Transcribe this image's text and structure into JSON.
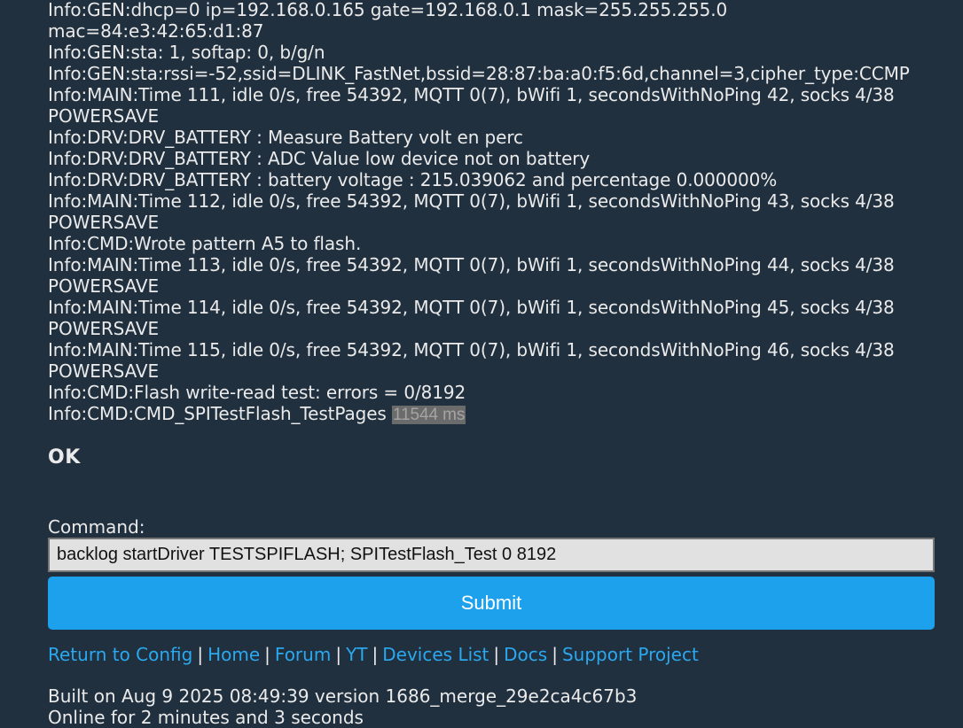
{
  "log": {
    "lines": [
      "Info:GEN:dhcp=0 ip=192.168.0.165 gate=192.168.0.1 mask=255.255.255.0",
      "mac=84:e3:42:65:d1:87",
      "Info:GEN:sta: 1, softap: 0, b/g/n",
      "Info:GEN:sta:rssi=-52,ssid=DLINK_FastNet,bssid=28:87:ba:a0:f5:6d,channel=3,cipher_type:CCMP",
      "Info:MAIN:Time 111, idle 0/s, free 54392, MQTT 0(7), bWifi 1, secondsWithNoPing 42, socks 4/38",
      "POWERSAVE",
      "Info:DRV:DRV_BATTERY : Measure Battery volt en perc",
      "Info:DRV:DRV_BATTERY : ADC Value low device not on battery",
      "Info:DRV:DRV_BATTERY : battery voltage : 215.039062 and percentage 0.000000%",
      "Info:MAIN:Time 112, idle 0/s, free 54392, MQTT 0(7), bWifi 1, secondsWithNoPing 43, socks 4/38",
      "POWERSAVE",
      "Info:CMD:Wrote pattern A5 to flash.",
      "Info:MAIN:Time 113, idle 0/s, free 54392, MQTT 0(7), bWifi 1, secondsWithNoPing 44, socks 4/38",
      "POWERSAVE",
      "Info:MAIN:Time 114, idle 0/s, free 54392, MQTT 0(7), bWifi 1, secondsWithNoPing 45, socks 4/38",
      "POWERSAVE",
      "Info:MAIN:Time 115, idle 0/s, free 54392, MQTT 0(7), bWifi 1, secondsWithNoPing 46, socks 4/38",
      "POWERSAVE",
      "Info:CMD:Flash write-read test: errors = 0/8192"
    ],
    "last_line": "Info:CMD:CMD_SPITestFlash_TestPages",
    "last_elapsed": "11544 ms"
  },
  "result": "OK",
  "command": {
    "label": "Command:",
    "value": "backlog startDriver TESTSPIFLASH; SPITestFlash_Test 0 8192",
    "submit_label": "Submit"
  },
  "links": {
    "items": [
      "Return to Config",
      "Home",
      "Forum",
      "YT",
      "Devices List",
      "Docs",
      "Support Project"
    ],
    "separator": "|"
  },
  "footer": {
    "built": "Built on Aug 9 2025 08:49:39 version 1686_merge_29e2ca4c67b3",
    "online": "Online for 2 minutes and 3 seconds"
  },
  "colors": {
    "background": "#21303f",
    "text": "#eaeaea",
    "link": "#2aa8f0",
    "button": "#1ea1ed"
  }
}
